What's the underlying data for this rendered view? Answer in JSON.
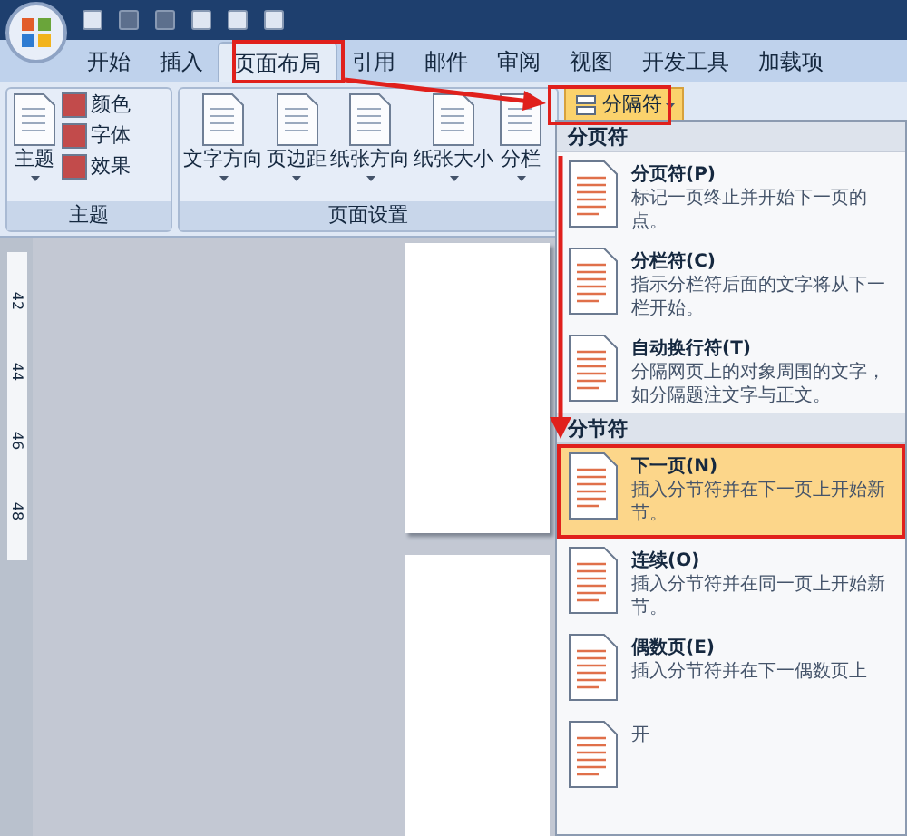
{
  "tabs": [
    {
      "label": "开始",
      "selected": false
    },
    {
      "label": "插入",
      "selected": false
    },
    {
      "label": "页面布局",
      "selected": true
    },
    {
      "label": "引用",
      "selected": false
    },
    {
      "label": "邮件",
      "selected": false
    },
    {
      "label": "审阅",
      "selected": false
    },
    {
      "label": "视图",
      "selected": false
    },
    {
      "label": "开发工具",
      "selected": false
    },
    {
      "label": "加载项",
      "selected": false
    }
  ],
  "ribbon": {
    "groups": [
      {
        "label": "主题",
        "buttons": [
          {
            "label": "主题",
            "kind": "large"
          },
          {
            "label": "颜色",
            "kind": "small"
          },
          {
            "label": "字体",
            "kind": "small"
          },
          {
            "label": "效果",
            "kind": "small"
          }
        ]
      },
      {
        "label": "页面设置",
        "buttons": [
          {
            "label": "文字方向",
            "kind": "large"
          },
          {
            "label": "页边距",
            "kind": "large"
          },
          {
            "label": "纸张方向",
            "kind": "large"
          },
          {
            "label": "纸张大小",
            "kind": "large"
          },
          {
            "label": "分栏",
            "kind": "large"
          }
        ]
      }
    ],
    "breaks_button": {
      "label": "分隔符",
      "selected": true
    }
  },
  "ruler": [
    "42",
    "44",
    "46",
    "48"
  ],
  "menu": {
    "sections": [
      {
        "header": "分页符",
        "items": [
          {
            "title": "分页符(P)",
            "description": "标记一页终止并开始下一页的点。",
            "selected": false
          },
          {
            "title": "分栏符(C)",
            "description": "指示分栏符后面的文字将从下一栏开始。",
            "selected": false
          },
          {
            "title": "自动换行符(T)",
            "description": "分隔网页上的对象周围的文字，如分隔题注文字与正文。",
            "selected": false
          }
        ]
      },
      {
        "header": "分节符",
        "items": [
          {
            "title": "下一页(N)",
            "description": "插入分节符并在下一页上开始新节。",
            "selected": true
          },
          {
            "title": "连续(O)",
            "description": "插入分节符并在同一页上开始新节。",
            "selected": false
          },
          {
            "title": "偶数页(E)",
            "description": "插入分节符并在下一偶数页上",
            "selected": false
          },
          {
            "description": "开",
            "selected": false
          }
        ]
      }
    ]
  }
}
